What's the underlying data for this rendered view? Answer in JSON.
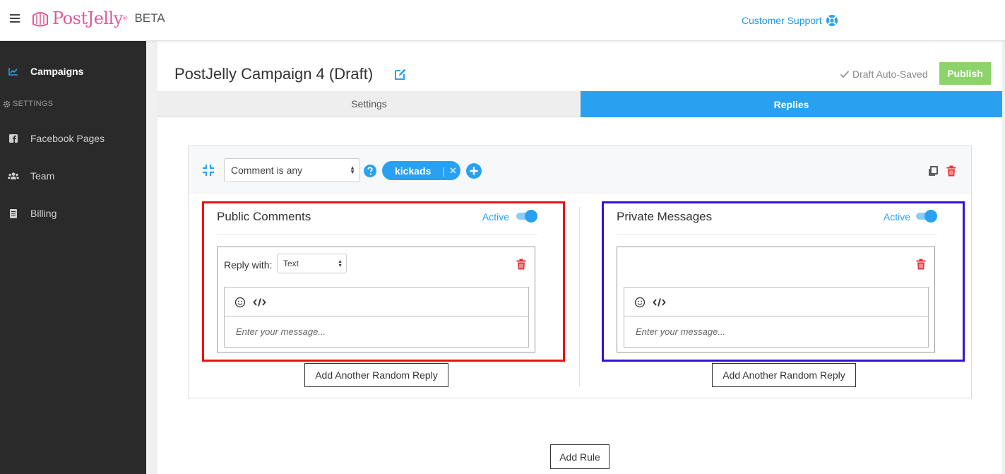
{
  "app": {
    "brand": "PostJelly",
    "brand_mark": "®",
    "badge": "BETA",
    "support_label": "Customer Support"
  },
  "sidebar": {
    "items": [
      {
        "label": "Campaigns",
        "icon": "chart-line-icon",
        "active": true
      },
      {
        "label": "Facebook Pages",
        "icon": "facebook-icon"
      },
      {
        "label": "Team",
        "icon": "users-icon"
      },
      {
        "label": "Billing",
        "icon": "document-icon"
      }
    ],
    "section_label": "SETTINGS"
  },
  "campaign": {
    "title": "PostJelly Campaign 4 (Draft)",
    "autosave_label": "Draft Auto-Saved",
    "publish_label": "Publish"
  },
  "tabs": [
    {
      "label": "Settings",
      "active": false
    },
    {
      "label": "Replies",
      "active": true
    }
  ],
  "rule": {
    "condition": "Comment is any",
    "keyword": "kickads",
    "keyword_sep": "|",
    "keyword_remove": "✕"
  },
  "public_comments": {
    "title": "Public Comments",
    "status": "Active",
    "reply_with_label": "Reply with:",
    "reply_type": "Text",
    "placeholder": "Enter your message...",
    "add_random_label": "Add Another Random Reply"
  },
  "private_messages": {
    "title": "Private Messages",
    "status": "Active",
    "placeholder": "Enter your message...",
    "add_random_label": "Add Another Random Reply"
  },
  "add_rule_label": "Add Rule",
  "colors": {
    "brand_pink": "#e0599a",
    "accent_blue": "#2aa1f0",
    "publish_green": "#8bd36a",
    "danger_red": "#e8333a",
    "sidebar_bg": "#2a2a2a",
    "highlight_public": "#ee1111",
    "highlight_private": "#3311dd"
  }
}
